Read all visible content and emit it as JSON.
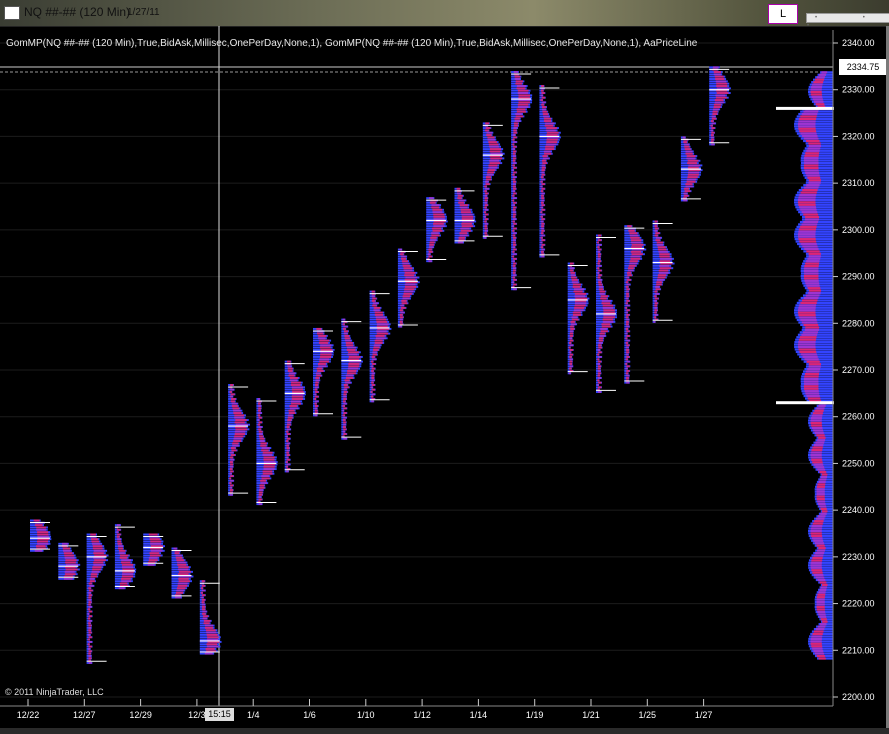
{
  "window": {
    "title": "NQ ##-## (120 Min)",
    "date": "1/27/11",
    "button_label": "L"
  },
  "indicator_label": "GomMP(NQ ##-## (120 Min),True,BidAsk,Millisec,OnePerDay,None,1), GomMP(NQ ##-## (120 Min),True,BidAsk,Millisec,OnePerDay,None,1), AaPriceLine",
  "copyright": "© 2011 NinjaTrader, LLC",
  "price_marker": "2334.75",
  "time_marker": "15:15",
  "colors": {
    "background": "#000000",
    "profile_blue": "#3344ff",
    "profile_magenta": "#ee2266",
    "profile_violet": "#aa33cc",
    "axis_text": "#ffffff"
  },
  "chart_data": {
    "type": "market-profile",
    "y_axis": {
      "ticks": [
        "2340.00",
        "2330.00",
        "2320.00",
        "2310.00",
        "2300.00",
        "2290.00",
        "2280.00",
        "2270.00",
        "2260.00",
        "2250.00",
        "2240.00",
        "2230.00",
        "2220.00",
        "2210.00",
        "2200.00"
      ],
      "ylim": [
        2200,
        2340
      ]
    },
    "x_axis": {
      "ticks": [
        "12/22",
        "12/27",
        "12/29",
        "12/3",
        "1/4",
        "1/6",
        "1/10",
        "1/12",
        "1/14",
        "1/19",
        "1/21",
        "1/25",
        "1/27"
      ]
    },
    "current_price": 2334.75,
    "profiles": [
      {
        "lo": 2231,
        "hi": 2238,
        "poc": 2234
      },
      {
        "lo": 2225,
        "hi": 2233,
        "poc": 2228
      },
      {
        "lo": 2207,
        "hi": 2235,
        "poc": 2230
      },
      {
        "lo": 2223,
        "hi": 2237,
        "poc": 2227
      },
      {
        "lo": 2228,
        "hi": 2235,
        "poc": 2232
      },
      {
        "lo": 2221,
        "hi": 2232,
        "poc": 2226
      },
      {
        "lo": 2209,
        "hi": 2225,
        "poc": 2212
      },
      {
        "lo": 2243,
        "hi": 2267,
        "poc": 2258
      },
      {
        "lo": 2241,
        "hi": 2264,
        "poc": 2250
      },
      {
        "lo": 2248,
        "hi": 2272,
        "poc": 2265
      },
      {
        "lo": 2260,
        "hi": 2279,
        "poc": 2274
      },
      {
        "lo": 2255,
        "hi": 2281,
        "poc": 2272
      },
      {
        "lo": 2263,
        "hi": 2287,
        "poc": 2279
      },
      {
        "lo": 2279,
        "hi": 2296,
        "poc": 2289
      },
      {
        "lo": 2293,
        "hi": 2307,
        "poc": 2302
      },
      {
        "lo": 2297,
        "hi": 2309,
        "poc": 2302
      },
      {
        "lo": 2298,
        "hi": 2323,
        "poc": 2316
      },
      {
        "lo": 2287,
        "hi": 2334,
        "poc": 2328
      },
      {
        "lo": 2294,
        "hi": 2331,
        "poc": 2320
      },
      {
        "lo": 2269,
        "hi": 2293,
        "poc": 2285
      },
      {
        "lo": 2265,
        "hi": 2299,
        "poc": 2282
      },
      {
        "lo": 2267,
        "hi": 2301,
        "poc": 2296
      },
      {
        "lo": 2280,
        "hi": 2302,
        "poc": 2293
      },
      {
        "lo": 2306,
        "hi": 2320,
        "poc": 2313
      },
      {
        "lo": 2318,
        "hi": 2335,
        "poc": 2330
      }
    ],
    "composite_lines": [
      2326,
      2263
    ]
  }
}
